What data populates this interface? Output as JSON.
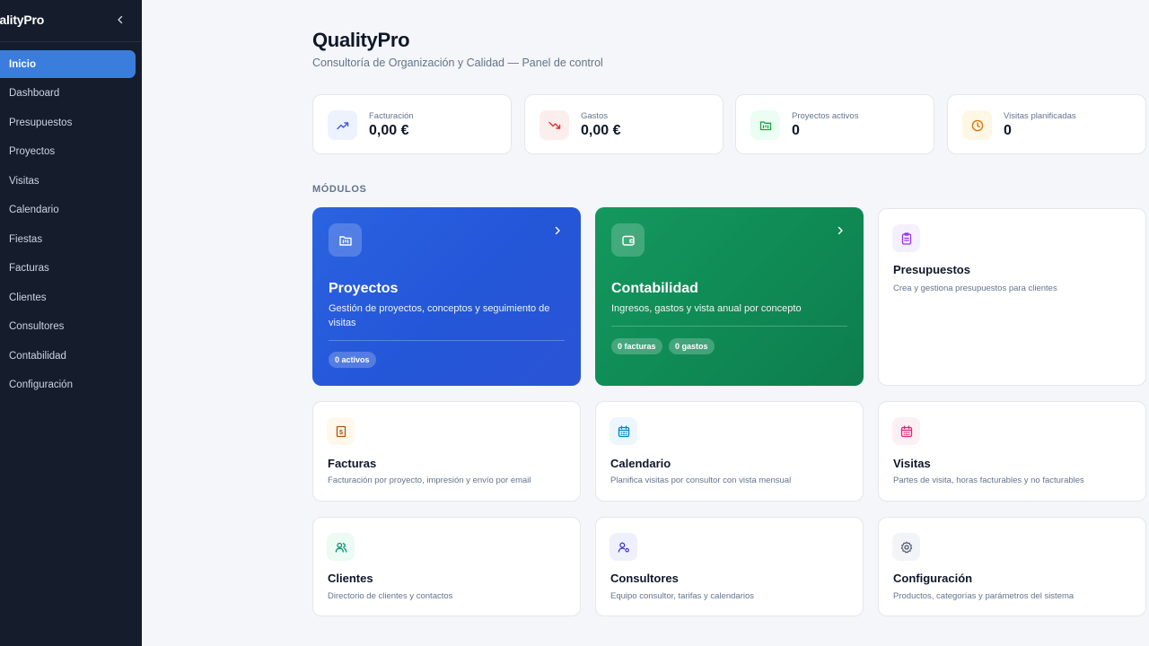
{
  "sidebar": {
    "brand": "ualityPro",
    "items": [
      {
        "label": "Inicio",
        "active": true
      },
      {
        "label": "Dashboard"
      },
      {
        "label": "Presupuestos"
      },
      {
        "label": "Proyectos"
      },
      {
        "label": "Visitas"
      },
      {
        "label": "Calendario"
      },
      {
        "label": "Fiestas"
      },
      {
        "label": "Facturas"
      },
      {
        "label": "Clientes"
      },
      {
        "label": "Consultores"
      },
      {
        "label": "Contabilidad"
      },
      {
        "label": "Configuración"
      }
    ]
  },
  "header": {
    "title": "QualityPro",
    "subtitle": "Consultoría de Organización y Calidad — Panel de control"
  },
  "stats": [
    {
      "label": "Facturación",
      "value": "0,00 €",
      "icon": "trending-up-icon",
      "color": "#3b5bdb"
    },
    {
      "label": "Gastos",
      "value": "0,00 €",
      "icon": "trending-down-icon",
      "color": "#e03131"
    },
    {
      "label": "Proyectos activos",
      "value": "0",
      "icon": "folder-kanban-icon",
      "color": "#16a34a"
    },
    {
      "label": "Visitas planificadas",
      "value": "0",
      "icon": "clock-icon",
      "color": "#d97706"
    }
  ],
  "modules_label": "MÓDULOS",
  "hero_cards": [
    {
      "title": "Proyectos",
      "description": "Gestión de proyectos, conceptos y seguimiento de visitas",
      "badges": [
        "0 activos"
      ],
      "icon": "folder-kanban-icon",
      "color": "#2456d8"
    },
    {
      "title": "Contabilidad",
      "description": "Ingresos, gastos y vista anual por concepto",
      "badges": [
        "0 facturas",
        "0 gastos"
      ],
      "icon": "wallet-icon",
      "color": "#0f8a55"
    }
  ],
  "cards": [
    {
      "title": "Presupuestos",
      "description": "Crea y gestiona presupuestos para clientes",
      "icon": "clipboard-list-icon",
      "color": "#9333ea"
    },
    {
      "title": "Facturas",
      "description": "Facturación por proyecto, impresión y envío por email",
      "icon": "receipt-icon",
      "color": "#b45309"
    },
    {
      "title": "Calendario",
      "description": "Planifica visitas por consultor con vista mensual",
      "icon": "calendar-icon",
      "color": "#0284c7"
    },
    {
      "title": "Visitas",
      "description": "Partes de visita, horas facturables y no facturables",
      "icon": "calendar-days-icon",
      "color": "#db2777"
    },
    {
      "title": "Clientes",
      "description": "Directorio de clientes y contactos",
      "icon": "users-icon",
      "color": "#059669"
    },
    {
      "title": "Consultores",
      "description": "Equipo consultor, tarifas y calendarios",
      "icon": "user-cog-icon",
      "color": "#4338ca"
    },
    {
      "title": "Configuración",
      "description": "Productos, categorías y parámetros del sistema",
      "icon": "settings-icon",
      "color": "#475569"
    }
  ]
}
